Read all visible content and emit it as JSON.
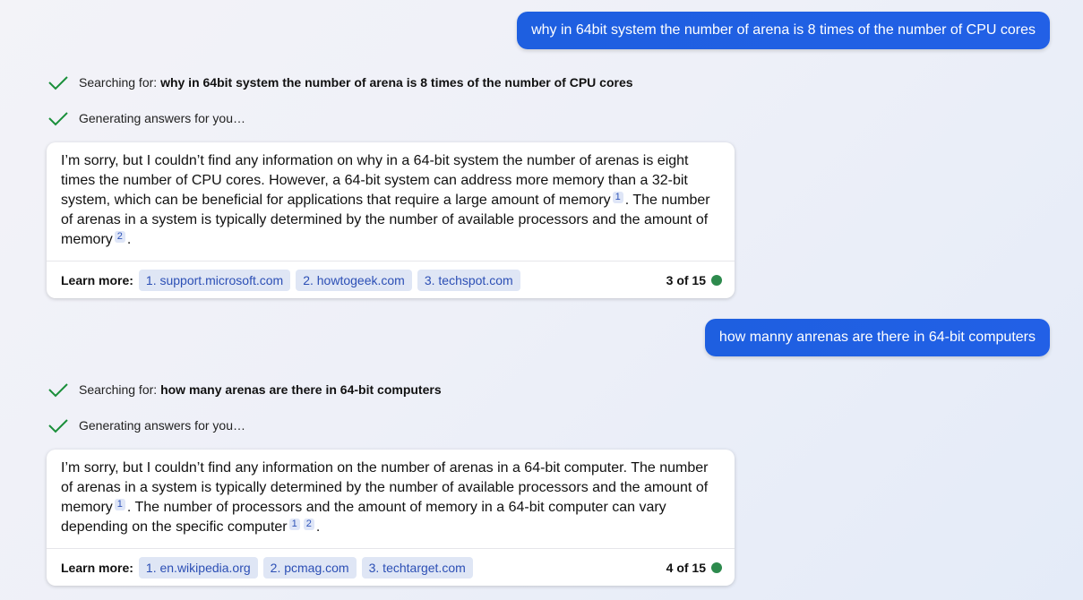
{
  "conversation": [
    {
      "user": "why in 64bit system the number of arena is 8 times of the number of CPU cores",
      "searching_label": "Searching for:",
      "searching_query": "why in 64bit system the number of arena is 8 times of the number of CPU cores",
      "generating": "Generating answers for you…",
      "answer": {
        "p1": "I’m sorry, but I couldn’t find any information on why in a 64-bit system the number of arenas is eight times the number of CPU cores. However, a 64-bit system can address more memory than a 32-bit system, which can be beneficial for applications that require a large amount of memory",
        "c1": "1",
        "p2": ". The number of arenas in a system is typically determined by the number of available processors and the amount of memory",
        "c2": "2",
        "p3": "."
      },
      "learn_more": "Learn more:",
      "sources": [
        "1. support.microsoft.com",
        "2. howtogeek.com",
        "3. techspot.com"
      ],
      "counter": "3 of 15"
    },
    {
      "user": "how manny anrenas are there in 64-bit computers",
      "searching_label": "Searching for:",
      "searching_query": "how many arenas are there in 64-bit computers",
      "generating": "Generating answers for you…",
      "answer": {
        "p1": "I’m sorry, but I couldn’t find any information on the number of arenas in a 64-bit computer. The number of arenas in a system is typically determined by the number of available processors and the amount of memory",
        "c1": "1",
        "p2": ". The number of processors and the amount of memory in a 64-bit computer can vary depending on the specific computer",
        "c2": "1",
        "c3": "2",
        "p3": "."
      },
      "learn_more": "Learn more:",
      "sources": [
        "1. en.wikipedia.org",
        "2. pcmag.com",
        "3. techtarget.com"
      ],
      "counter": "4 of 15"
    }
  ],
  "colors": {
    "user_bubble": "#1e5fe0",
    "check": "#1a8f3a",
    "status_dot": "#2d8a4d",
    "citation_bg": "#dfe6f7",
    "link_text": "#2c4fb5"
  }
}
